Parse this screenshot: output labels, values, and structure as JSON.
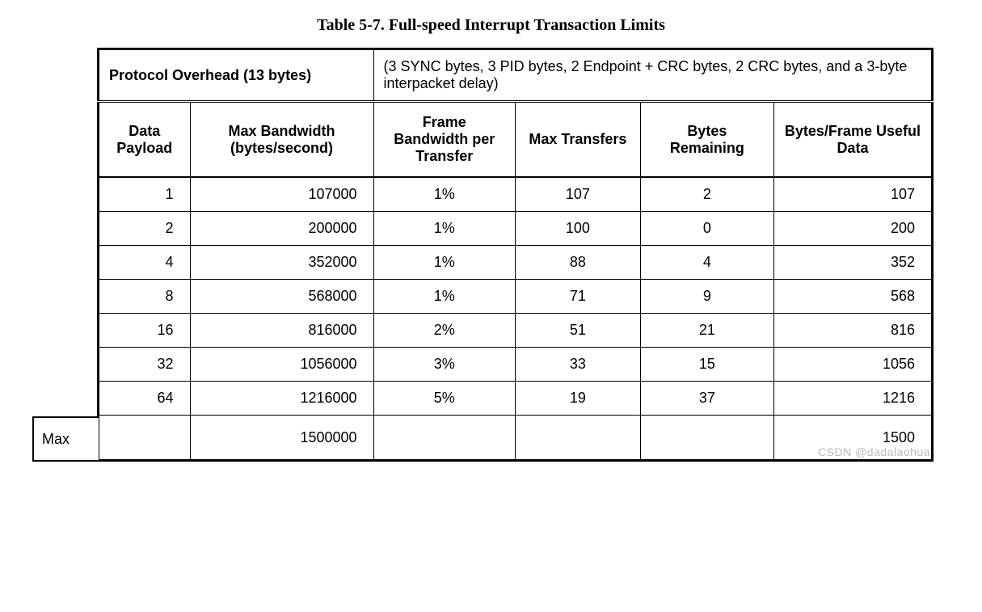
{
  "title": "Table 5-7.  Full-speed Interrupt Transaction Limits",
  "overhead": {
    "label": "Protocol Overhead (13 bytes)",
    "desc": "(3 SYNC bytes, 3 PID bytes, 2 Endpoint + CRC bytes, 2 CRC bytes, and a 3-byte interpacket delay)"
  },
  "columns": [
    "Data Payload",
    "Max Bandwidth (bytes/second)",
    "Frame Bandwidth per Transfer",
    "Max Transfers",
    "Bytes Remaining",
    "Bytes/Frame Useful Data"
  ],
  "rows": [
    {
      "payload": "1",
      "bw": "107000",
      "frame": "1%",
      "xfer": "107",
      "remain": "2",
      "useful": "107"
    },
    {
      "payload": "2",
      "bw": "200000",
      "frame": "1%",
      "xfer": "100",
      "remain": "0",
      "useful": "200"
    },
    {
      "payload": "4",
      "bw": "352000",
      "frame": "1%",
      "xfer": "88",
      "remain": "4",
      "useful": "352"
    },
    {
      "payload": "8",
      "bw": "568000",
      "frame": "1%",
      "xfer": "71",
      "remain": "9",
      "useful": "568"
    },
    {
      "payload": "16",
      "bw": "816000",
      "frame": "2%",
      "xfer": "51",
      "remain": "21",
      "useful": "816"
    },
    {
      "payload": "32",
      "bw": "1056000",
      "frame": "3%",
      "xfer": "33",
      "remain": "15",
      "useful": "1056"
    },
    {
      "payload": "64",
      "bw": "1216000",
      "frame": "5%",
      "xfer": "19",
      "remain": "37",
      "useful": "1216"
    }
  ],
  "maxrow": {
    "label": "Max",
    "payload": "",
    "bw": "1500000",
    "frame": "",
    "xfer": "",
    "remain": "",
    "useful": "1500"
  },
  "watermark": "CSDN @dadalaohua",
  "chart_data": {
    "type": "table",
    "title": "Table 5-7. Full-speed Interrupt Transaction Limits",
    "columns": [
      "Data Payload",
      "Max Bandwidth (bytes/second)",
      "Frame Bandwidth per Transfer",
      "Max Transfers",
      "Bytes Remaining",
      "Bytes/Frame Useful Data"
    ],
    "rows": [
      [
        1,
        107000,
        "1%",
        107,
        2,
        107
      ],
      [
        2,
        200000,
        "1%",
        100,
        0,
        200
      ],
      [
        4,
        352000,
        "1%",
        88,
        4,
        352
      ],
      [
        8,
        568000,
        "1%",
        71,
        9,
        568
      ],
      [
        16,
        816000,
        "2%",
        51,
        21,
        816
      ],
      [
        32,
        1056000,
        "3%",
        33,
        15,
        1056
      ],
      [
        64,
        1216000,
        "5%",
        19,
        37,
        1216
      ],
      [
        "Max",
        1500000,
        "",
        "",
        "",
        1500
      ]
    ]
  }
}
